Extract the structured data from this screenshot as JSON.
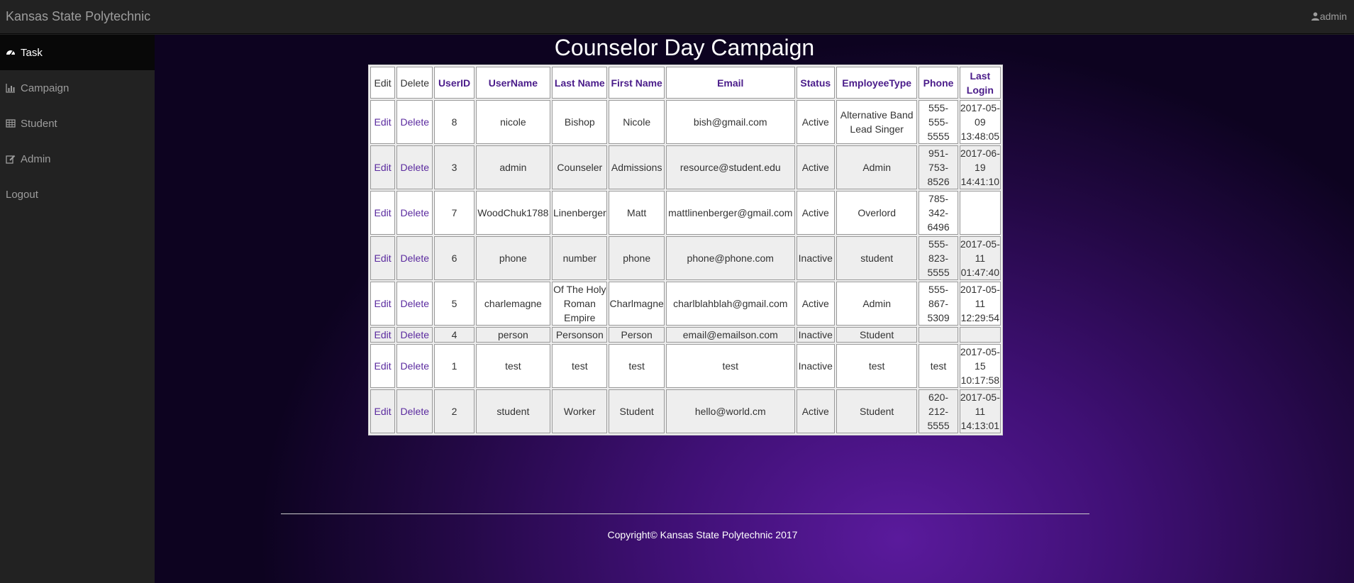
{
  "navbar": {
    "brand": "Kansas State Polytechnic",
    "user_label": "admin",
    "user_icon": "user-icon"
  },
  "sidebar": {
    "items": [
      {
        "label": "Task",
        "icon": "dashboard-icon",
        "active": true
      },
      {
        "label": "Campaign",
        "icon": "bar-chart-icon"
      },
      {
        "label": "Student",
        "icon": "table-icon"
      },
      {
        "label": "Admin",
        "icon": "edit-icon"
      },
      {
        "label": "Logout",
        "icon": ""
      }
    ]
  },
  "main": {
    "title": "Counselor Day Campaign",
    "table": {
      "headers": [
        "Edit",
        "Delete",
        "UserID",
        "UserName",
        "Last Name",
        "First Name",
        "Email",
        "Status",
        "EmployeeType",
        "Phone",
        "Last Login"
      ],
      "rows": [
        {
          "edit": "Edit",
          "delete": "Delete",
          "id": "8",
          "username": "nicole",
          "last": "Bishop",
          "first": "Nicole",
          "email": "bish@gmail.com",
          "status": "Active",
          "type": "Alternative Band Lead Singer",
          "phone": "555-555-5555",
          "login": "2017-05-09 13:48:05"
        },
        {
          "edit": "Edit",
          "delete": "Delete",
          "id": "3",
          "username": "admin",
          "last": "Counseler",
          "first": "Admissions",
          "email": "resource@student.edu",
          "status": "Active",
          "type": "Admin",
          "phone": "951-753-8526",
          "login": "2017-06-19 14:41:10"
        },
        {
          "edit": "Edit",
          "delete": "Delete",
          "id": "7",
          "username": "WoodChuk1788",
          "last": "Linenberger",
          "first": "Matt",
          "email": "mattlinenberger@gmail.com",
          "status": "Active",
          "type": "Overlord",
          "phone": "785-342-6496",
          "login": ""
        },
        {
          "edit": "Edit",
          "delete": "Delete",
          "id": "6",
          "username": "phone",
          "last": "number",
          "first": "phone",
          "email": "phone@phone.com",
          "status": "Inactive",
          "type": "student",
          "phone": "555-823-5555",
          "login": "2017-05-11 01:47:40"
        },
        {
          "edit": "Edit",
          "delete": "Delete",
          "id": "5",
          "username": "charlemagne",
          "last": "Of The Holy Roman Empire",
          "first": "Charlmagne",
          "email": "charlblahblah@gmail.com",
          "status": "Active",
          "type": "Admin",
          "phone": "555-867-5309",
          "login": "2017-05-11 12:29:54"
        },
        {
          "edit": "Edit",
          "delete": "Delete",
          "id": "4",
          "username": "person",
          "last": "Personson",
          "first": "Person",
          "email": "email@emailson.com",
          "status": "Inactive",
          "type": "Student",
          "phone": "",
          "login": ""
        },
        {
          "edit": "Edit",
          "delete": "Delete",
          "id": "1",
          "username": "test",
          "last": "test",
          "first": "test",
          "email": "test",
          "status": "Inactive",
          "type": "test",
          "phone": "test",
          "login": "2017-05-15 10:17:58"
        },
        {
          "edit": "Edit",
          "delete": "Delete",
          "id": "2",
          "username": "student",
          "last": "Worker",
          "first": "Student",
          "email": "hello@world.cm",
          "status": "Active",
          "type": "Student",
          "phone": "620-212-5555",
          "login": "2017-05-11 14:13:01"
        }
      ]
    }
  },
  "footer": {
    "copyright": "Copyright© Kansas State Polytechnic 2017"
  }
}
